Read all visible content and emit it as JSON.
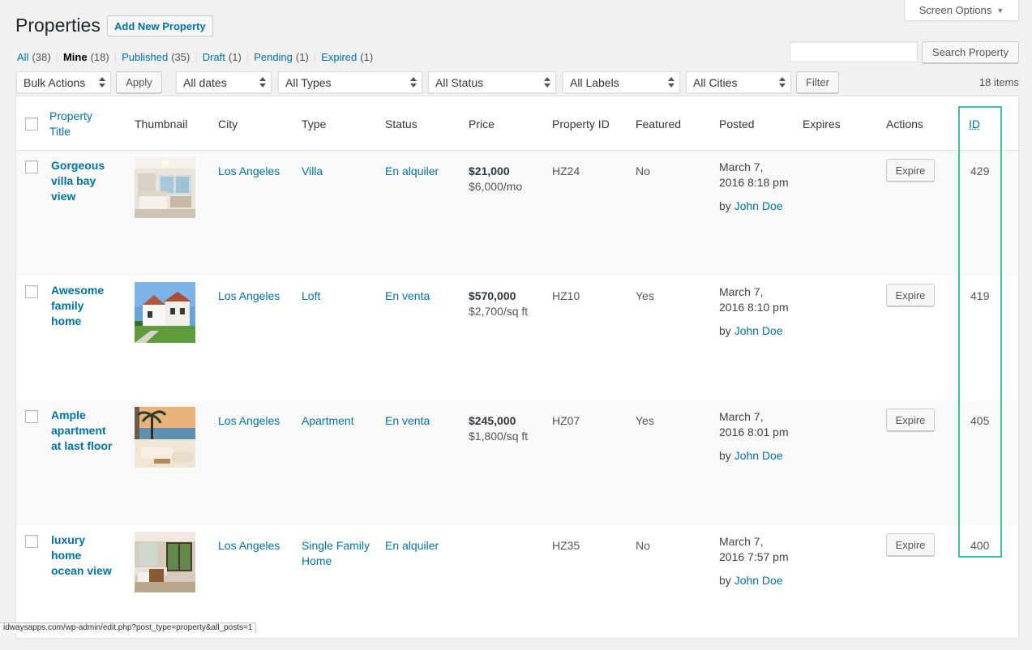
{
  "screen_options": {
    "label": "Screen Options"
  },
  "header": {
    "title": "Properties",
    "add_new_label": "Add New Property"
  },
  "views": [
    {
      "label": "All",
      "count": "(38)",
      "current": false
    },
    {
      "label": "Mine",
      "count": "(18)",
      "current": true
    },
    {
      "label": "Published",
      "count": "(35)",
      "current": false
    },
    {
      "label": "Draft",
      "count": "(1)",
      "current": false
    },
    {
      "label": "Pending",
      "count": "(1)",
      "current": false
    },
    {
      "label": "Expired",
      "count": "(1)",
      "current": false
    }
  ],
  "search": {
    "value": "",
    "button_label": "Search Property"
  },
  "filters": {
    "bulk_actions": "Bulk Actions",
    "apply": "Apply",
    "dates": "All dates",
    "types": "All Types",
    "status": "All Status",
    "labels": "All Labels",
    "cities": "All Cities",
    "filter": "Filter",
    "items_count": "18 items"
  },
  "columns": {
    "title_line1": "Property",
    "title_line2": "Title",
    "thumbnail": "Thumbnail",
    "city": "City",
    "type": "Type",
    "status": "Status",
    "price": "Price",
    "property_id": "Property ID",
    "featured": "Featured",
    "posted": "Posted",
    "expires": "Expires",
    "actions": "Actions",
    "id": "ID"
  },
  "rows": [
    {
      "title_lines": [
        "Gorgeous",
        "villa bay",
        "view"
      ],
      "thumbnail": "bedroom-interior",
      "city": "Los Angeles",
      "type_lines": [
        "Villa",
        ""
      ],
      "status": "En alquiler",
      "price_main": "$21,000",
      "price_sub": "$6,000/mo",
      "property_id": "HZ24",
      "featured": "No",
      "posted_line1": "March 7,",
      "posted_line2": "2016 8:18 pm",
      "by": "by",
      "author": "John Doe",
      "expires": "",
      "action": "Expire",
      "id": "429"
    },
    {
      "title_lines": [
        "Awesome",
        "family",
        "home"
      ],
      "thumbnail": "white-house-exterior",
      "city": "Los Angeles",
      "type_lines": [
        "Loft",
        ""
      ],
      "status": "En venta",
      "price_main": "$570,000",
      "price_sub": "$2,700/sq ft",
      "property_id": "HZ10",
      "featured": "Yes",
      "posted_line1": "March 7,",
      "posted_line2": "2016 8:10 pm",
      "by": "by",
      "author": "John Doe",
      "expires": "",
      "action": "Expire",
      "id": "419"
    },
    {
      "title_lines": [
        "Ample",
        "apartment",
        "at last floor"
      ],
      "thumbnail": "palm-terrace",
      "city": "Los Angeles",
      "type_lines": [
        "Apartment",
        ""
      ],
      "status": "En venta",
      "price_main": "$245,000",
      "price_sub": "$1,800/sq ft",
      "property_id": "HZ07",
      "featured": "Yes",
      "posted_line1": "March 7,",
      "posted_line2": "2016 8:01 pm",
      "by": "by",
      "author": "John Doe",
      "expires": "",
      "action": "Expire",
      "id": "405"
    },
    {
      "title_lines": [
        "luxury",
        "home",
        "ocean view"
      ],
      "thumbnail": "bathroom-interior",
      "city": "Los Angeles",
      "type_lines": [
        "Single Family",
        "Home"
      ],
      "status": "En alquiler",
      "price_main": "",
      "price_sub": "",
      "property_id": "HZ35",
      "featured": "No",
      "posted_line1": "March 7,",
      "posted_line2": "2016 7:57 pm",
      "by": "by",
      "author": "John Doe",
      "expires": "",
      "action": "Expire",
      "id": "400"
    }
  ],
  "status_bar": {
    "url": "idwaysapps.com/wp-admin/edit.php?post_type=property&all_posts=1"
  },
  "colors": {
    "link": "#0073aa",
    "highlight": "#3fc1a2",
    "text": "#32373c"
  }
}
